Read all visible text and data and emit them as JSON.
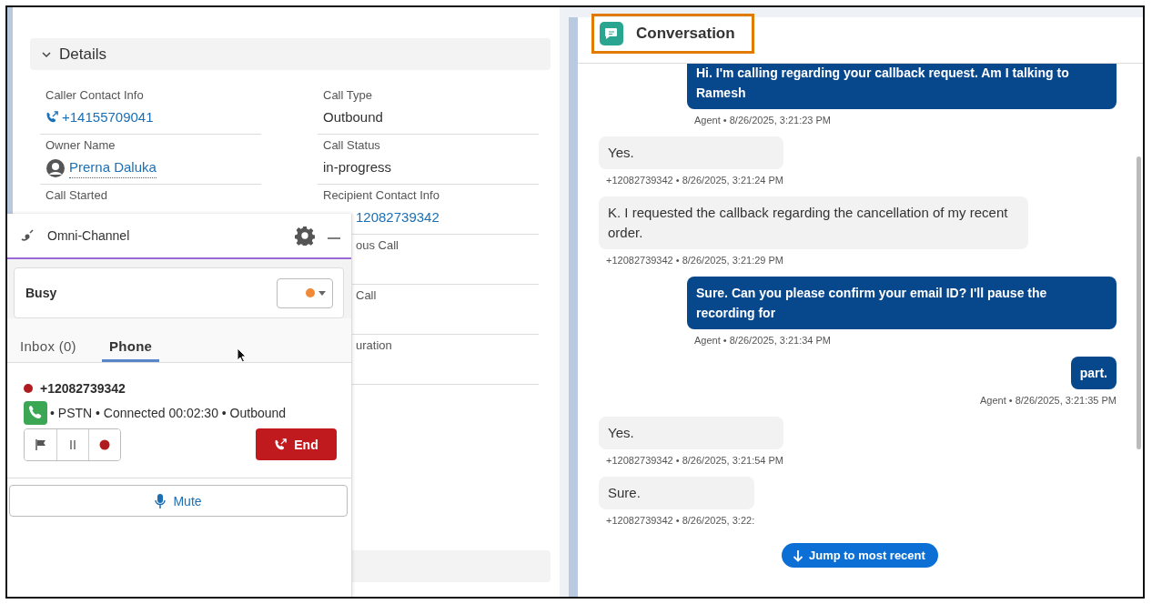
{
  "details": {
    "title": "Details",
    "expanded": true,
    "fields_left": [
      {
        "label": "Caller Contact Info",
        "value": "+14155709041",
        "kind": "phone"
      },
      {
        "label": "Owner Name",
        "value": "Prerna Daluka",
        "kind": "user"
      },
      {
        "label": "Call Started"
      }
    ],
    "fields_right": [
      {
        "label": "Call Type",
        "value": "Outbound",
        "kind": "text"
      },
      {
        "label": "Call Status",
        "value": "in-progress",
        "kind": "text"
      },
      {
        "label": "Recipient Contact Info",
        "value": "12082739342",
        "kind": "link"
      },
      {
        "label": "ous Call"
      },
      {
        "label": "Call"
      },
      {
        "label": "uration"
      }
    ]
  },
  "omni_channel": {
    "title": "Omni-Channel",
    "status": "Busy",
    "tabs": [
      {
        "label": "Inbox (0)",
        "selected": false
      },
      {
        "label": "Phone",
        "selected": true
      }
    ],
    "call": {
      "number": "+12082739342",
      "info": "• PSTN • Connected 00:02:30 • Outbound",
      "end_label": "End"
    },
    "mute_label": "Mute"
  },
  "conversation": {
    "title": "Conversation",
    "messages": [
      {
        "kind": "agent",
        "text": "Hi. I'm calling regarding your callback request. Am I talking to Ramesh",
        "meta": "Agent • 8/26/2025, 3:21:23 PM"
      },
      {
        "kind": "customer",
        "text": "Yes.",
        "meta": "+12082739342 • 8/26/2025, 3:21:24 PM"
      },
      {
        "kind": "customer",
        "text": "K. I requested the callback regarding the cancellation of my recent order.",
        "meta": "+12082739342 • 8/26/2025, 3:21:29 PM"
      },
      {
        "kind": "agent",
        "text": "Sure. Can you please confirm your email ID? I'll pause the recording for",
        "meta": "Agent • 8/26/2025, 3:21:34 PM"
      },
      {
        "kind": "agent",
        "text": "part.",
        "meta": "Agent • 8/26/2025, 3:21:35 PM"
      },
      {
        "kind": "customer",
        "text": "Yes.",
        "meta": "+12082739342 • 8/26/2025, 3:21:54 PM"
      },
      {
        "kind": "customer",
        "text": "Sure.",
        "meta": "+12082739342 • 8/26/2025, 3:22:"
      }
    ],
    "jump_label": "Jump to most recent"
  }
}
